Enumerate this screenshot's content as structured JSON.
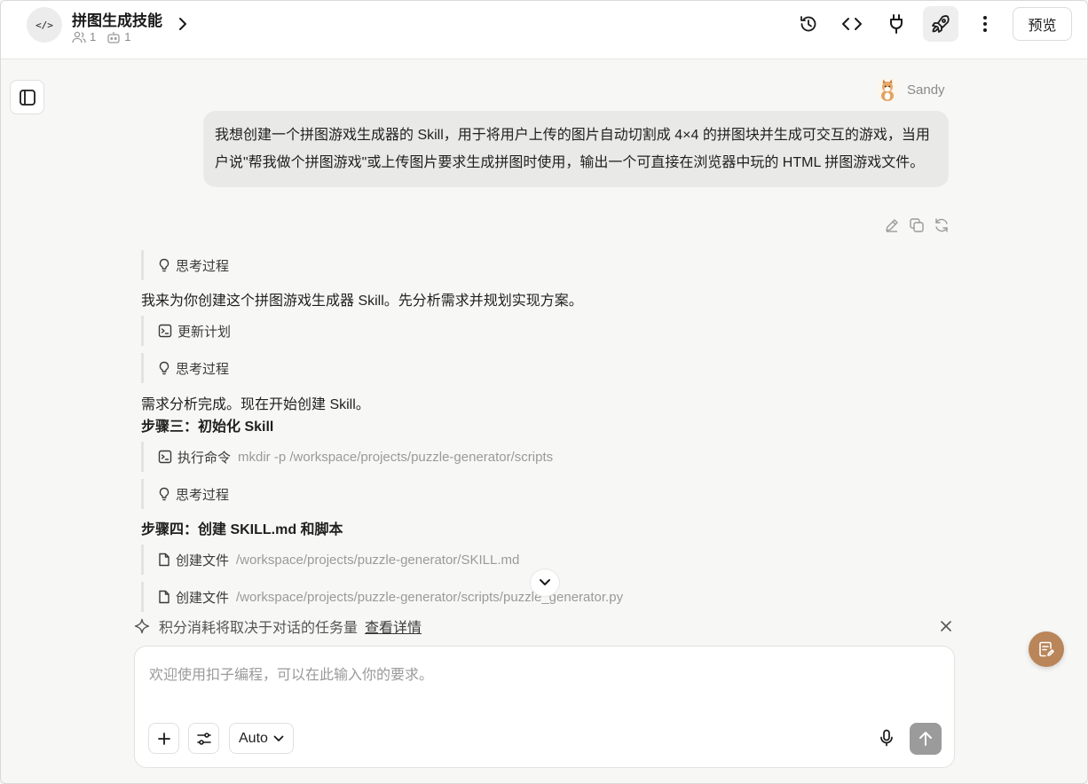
{
  "header": {
    "project_icon": "</>",
    "project_title": "拼图生成技能",
    "members_count": "1",
    "bots_count": "1",
    "preview_label": "预览",
    "icons": [
      "history-icon",
      "code-icon",
      "plug-icon",
      "rocket-icon",
      "more-vertical-icon"
    ]
  },
  "user_message": {
    "name": "Sandy",
    "text": "我想创建一个拼图游戏生成器的 Skill，用于将用户上传的图片自动切割成 4×4 的拼图块并生成可交互的游戏，当用户说\"帮我做个拼图游戏\"或上传图片要求生成拼图时使用，输出一个可直接在浏览器中玩的 HTML 拼图游戏文件。"
  },
  "assistant": {
    "thinking_1": "思考过程",
    "intro": "我来为你创建这个拼图游戏生成器 Skill。先分析需求并规划实现方案。",
    "update_plan": "更新计划",
    "thinking_2": "思考过程",
    "analysis_done": "需求分析完成。现在开始创建 Skill。",
    "step3_title": "步骤三：初始化 Skill",
    "exec_label": "执行命令",
    "exec_cmd": "mkdir -p /workspace/projects/puzzle-generator/scripts",
    "thinking_3": "思考过程",
    "step4_title": "步骤四：创建 SKILL.md 和脚本",
    "create_file_label_1": "创建文件",
    "create_file_path_1": "/workspace/projects/puzzle-generator/SKILL.md",
    "create_file_label_2": "创建文件",
    "create_file_path_2": "/workspace/projects/puzzle-generator/scripts/puzzle_generator.py"
  },
  "notice": {
    "text": "积分消耗将取决于对话的任务量",
    "link": "查看详情"
  },
  "composer": {
    "placeholder": "欢迎使用扣子编程，可以在此输入你的要求。",
    "mode": "Auto"
  },
  "colors": {
    "accent_fab": "#b98559",
    "send_disabled": "#9b9b9b",
    "user_bubble": "#e9e9e8"
  }
}
